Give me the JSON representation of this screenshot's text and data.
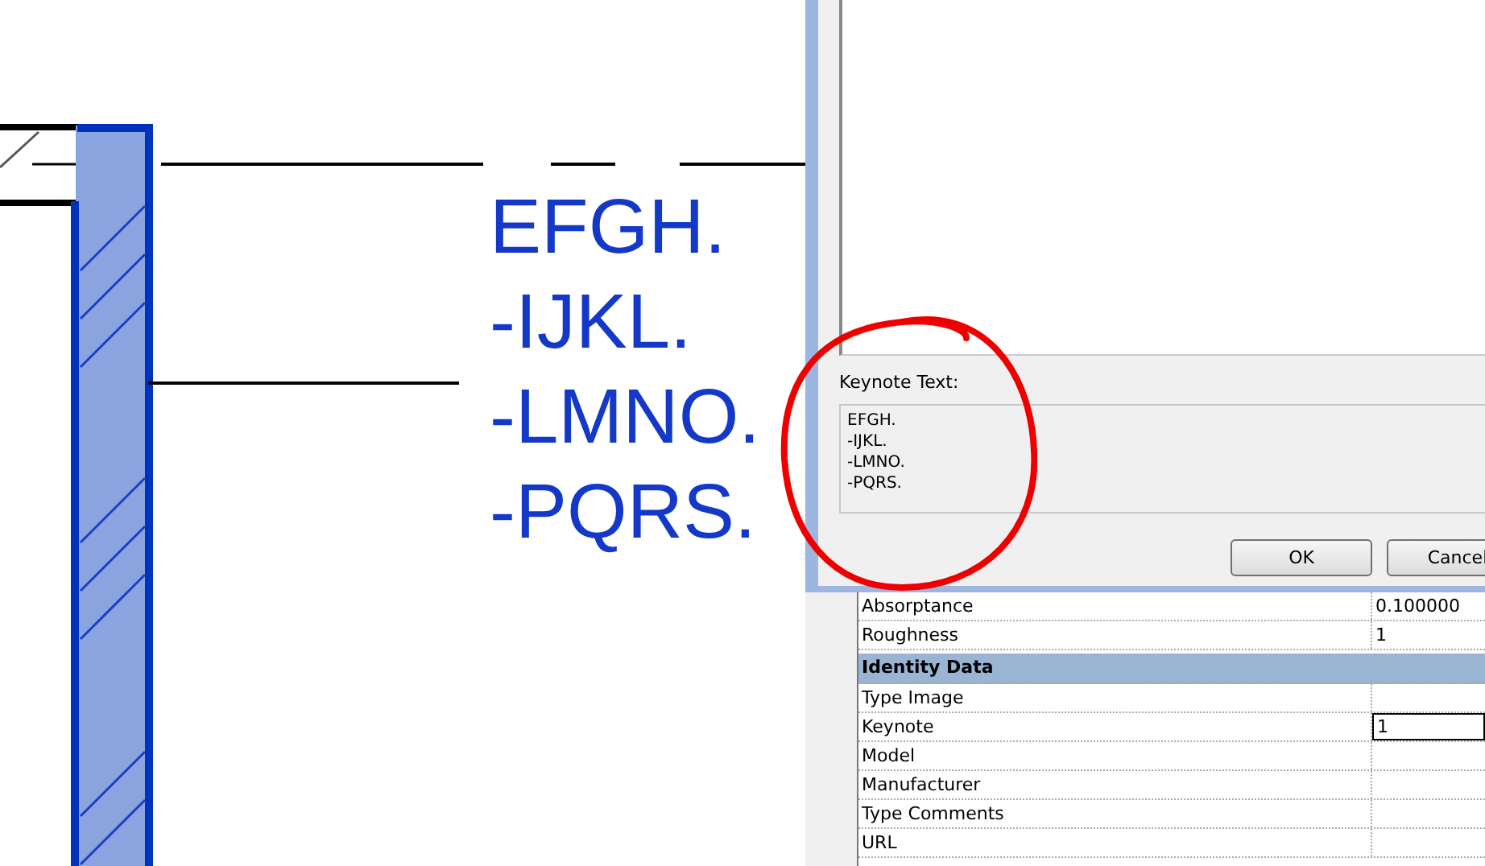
{
  "canvas": {
    "keynote_tag": "EFGH.\n-IJKL.\n-LMNO.\n-PQRS."
  },
  "dialog": {
    "keynote_label": "Keynote Text:",
    "keynote_text": "EFGH.\n-IJKL.\n-LMNO.\n-PQRS.",
    "buttons": [
      "OK",
      "Cancel"
    ]
  },
  "properties": {
    "rows": [
      {
        "kind": "param",
        "name": "Absorptance",
        "value": "0.100000"
      },
      {
        "kind": "param",
        "name": "Roughness",
        "value": "1"
      },
      {
        "kind": "group",
        "name": "Identity Data"
      },
      {
        "kind": "param",
        "name": "Type Image"
      },
      {
        "kind": "param",
        "name": "Keynote",
        "value": "1",
        "editing": true
      },
      {
        "kind": "param",
        "name": "Model"
      },
      {
        "kind": "param",
        "name": "Manufacturer"
      },
      {
        "kind": "param",
        "name": "Type Comments"
      },
      {
        "kind": "param",
        "name": "URL"
      }
    ]
  }
}
